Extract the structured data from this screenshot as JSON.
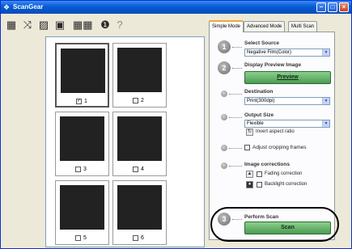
{
  "window": {
    "title": "ScanGear"
  },
  "toolbar": {
    "icons": [
      "zoom-icon",
      "rotate-icon",
      "crop-icon",
      "thumbnail-view-icon",
      "info-icon",
      "help-icon"
    ]
  },
  "thumbnails": [
    {
      "number": "1",
      "checked": true
    },
    {
      "number": "2",
      "checked": false
    },
    {
      "number": "3",
      "checked": false
    },
    {
      "number": "4",
      "checked": false
    },
    {
      "number": "5",
      "checked": false
    },
    {
      "number": "6",
      "checked": false
    }
  ],
  "tabs": [
    "Simple Mode",
    "Advanced Mode",
    "Multi Scan"
  ],
  "panel": {
    "step1": {
      "num": "1",
      "label": "Select Source",
      "value": "Negative Film(Color)"
    },
    "step2": {
      "num": "2",
      "label": "Display Preview Image",
      "button": "Preview"
    },
    "destination": {
      "label": "Destination",
      "value": "Print(300dpi)"
    },
    "output": {
      "label": "Output Size",
      "value": "Flexible",
      "invert": "Invert aspect ratio"
    },
    "adjust": {
      "label": "Adjust cropping frames"
    },
    "corrections": {
      "label": "Image corrections",
      "fading": "Fading correction",
      "backlight": "Backlight correction"
    },
    "step3": {
      "num": "3",
      "label": "Perform Scan",
      "button": "Scan"
    }
  },
  "colors": {
    "titlebar": "#0a5fd8",
    "scan_button": "#5aa85f",
    "tab_accent": "#f1a53f"
  }
}
